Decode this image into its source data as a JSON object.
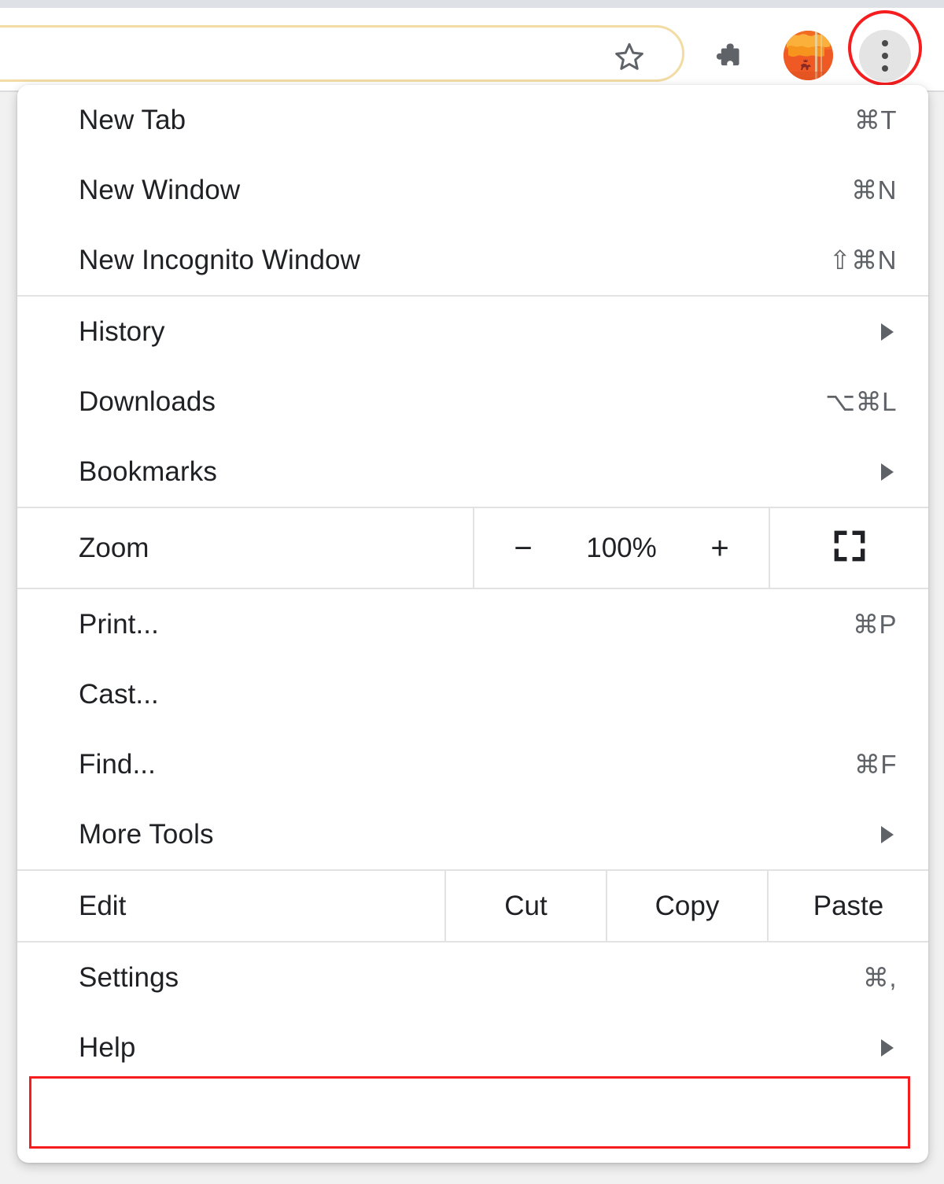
{
  "browser": {
    "toolbar": {
      "bookmark_icon": "star-icon",
      "extensions_icon": "puzzle-piece-icon",
      "profile_icon": "avatar",
      "menu_icon": "three-dot-menu-icon"
    },
    "highlight_color": "#f51d1d",
    "omnibox_border_color": "#f2dca4"
  },
  "menu": {
    "groups": [
      {
        "id": "new",
        "items": [
          {
            "label": "New Tab",
            "accel": "⌘T",
            "submenu": false
          },
          {
            "label": "New Window",
            "accel": "⌘N",
            "submenu": false
          },
          {
            "label": "New Incognito Window",
            "accel": "⇧⌘N",
            "submenu": false
          }
        ]
      },
      {
        "id": "browse",
        "items": [
          {
            "label": "History",
            "accel": "",
            "submenu": true
          },
          {
            "label": "Downloads",
            "accel": "⌥⌘L",
            "submenu": false
          },
          {
            "label": "Bookmarks",
            "accel": "",
            "submenu": true
          }
        ]
      },
      {
        "id": "tools",
        "items": [
          {
            "label": "Print...",
            "accel": "⌘P",
            "submenu": false
          },
          {
            "label": "Cast...",
            "accel": "",
            "submenu": false
          },
          {
            "label": "Find...",
            "accel": "⌘F",
            "submenu": false
          },
          {
            "label": "More Tools",
            "accel": "",
            "submenu": true
          }
        ]
      },
      {
        "id": "footer",
        "items": [
          {
            "label": "Settings",
            "accel": "⌘,",
            "submenu": false
          },
          {
            "label": "Help",
            "accel": "",
            "submenu": true
          }
        ]
      }
    ],
    "zoom_row": {
      "label": "Zoom",
      "decrease_label": "−",
      "value": "100%",
      "increase_label": "+",
      "fullscreen_icon": "fullscreen-icon"
    },
    "edit_row": {
      "label": "Edit",
      "actions": [
        "Cut",
        "Copy",
        "Paste"
      ]
    },
    "highlighted_item": "Help"
  }
}
